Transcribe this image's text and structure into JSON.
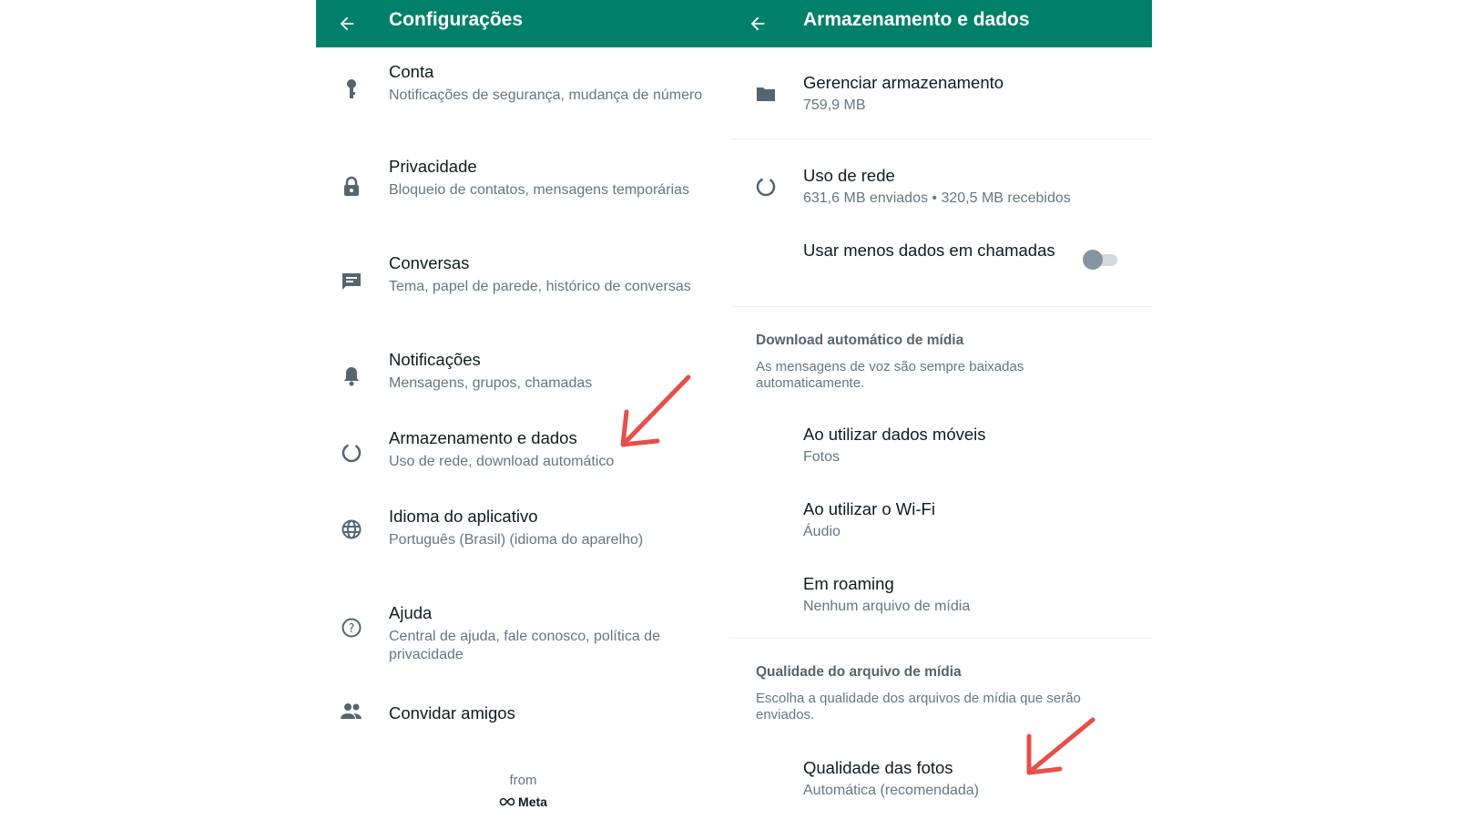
{
  "left": {
    "appbar": {
      "title": "Configurações"
    },
    "items": [
      {
        "title": "Conta",
        "subtitle": "Notificações de segurança, mudança de número",
        "icon": "key-icon"
      },
      {
        "title": "Privacidade",
        "subtitle": "Bloqueio de contatos, mensagens temporárias",
        "icon": "lock-icon"
      },
      {
        "title": "Conversas",
        "subtitle": "Tema, papel de parede, histórico de conversas",
        "icon": "chat-icon"
      },
      {
        "title": "Notificações",
        "subtitle": "Mensagens, grupos, chamadas",
        "icon": "bell-icon"
      },
      {
        "title": "Armazenamento e dados",
        "subtitle": "Uso de rede, download automático",
        "icon": "data-usage-icon"
      },
      {
        "title": "Idioma do aplicativo",
        "subtitle": "Português (Brasil) (idioma do aparelho)",
        "icon": "globe-icon"
      },
      {
        "title": "Ajuda",
        "subtitle": "Central de ajuda, fale conosco, política de privacidade",
        "icon": "help-icon"
      },
      {
        "title": "Convidar amigos",
        "icon": "people-icon"
      }
    ],
    "footer": {
      "from": "from",
      "brand": "Meta"
    }
  },
  "right": {
    "appbar": {
      "title": "Armazenamento e dados"
    },
    "manage_storage": {
      "title": "Gerenciar armazenamento",
      "subtitle": "759,9 MB",
      "icon": "folder-icon"
    },
    "network_usage": {
      "title": "Uso de rede",
      "subtitle": "631,6 MB enviados • 320,5 MB recebidos",
      "icon": "data-usage-icon"
    },
    "less_data": {
      "title": "Usar menos dados em chamadas",
      "toggle_on": false
    },
    "auto_download": {
      "section_title": "Download automático de mídia",
      "section_desc": "As mensagens de voz são sempre baixadas automaticamente.",
      "items": [
        {
          "title": "Ao utilizar dados móveis",
          "subtitle": "Fotos"
        },
        {
          "title": "Ao utilizar o Wi-Fi",
          "subtitle": "Áudio"
        },
        {
          "title": "Em roaming",
          "subtitle": "Nenhum arquivo de mídia"
        }
      ]
    },
    "media_quality": {
      "section_title": "Qualidade do arquivo de mídia",
      "section_desc": "Escolha a qualidade dos arquivos de mídia que serão enviados.",
      "photo_quality": {
        "title": "Qualidade das fotos",
        "subtitle": "Automática (recomendada)"
      }
    }
  },
  "colors": {
    "header": "#008069",
    "title_text": "#111b21",
    "subtitle_text": "#667781",
    "icon": "#54656f",
    "annotation_arrow": "#e5504a"
  }
}
